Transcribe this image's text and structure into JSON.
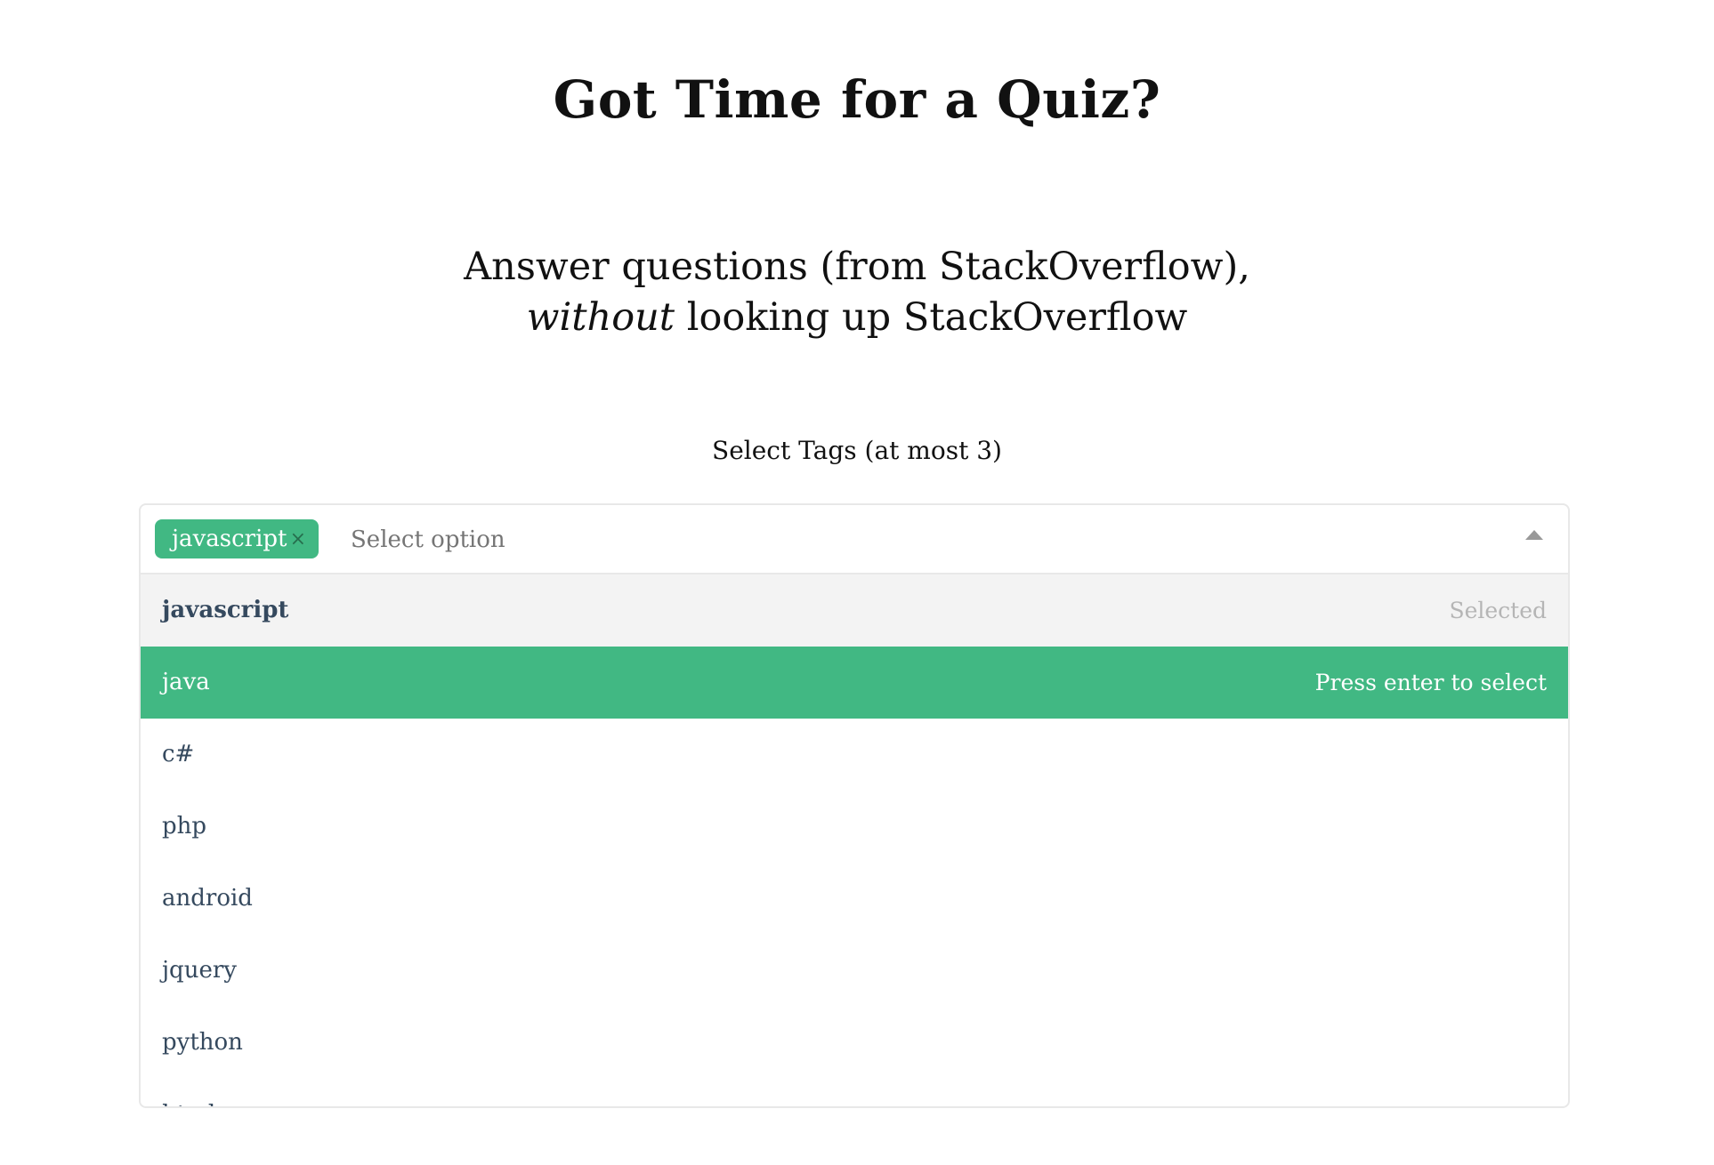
{
  "header": {
    "title": "Got Time for a Quiz?",
    "subtitle_line1": "Answer questions (from StackOverflow),",
    "subtitle_italic": "without",
    "subtitle_line2_rest": " looking up StackOverflow"
  },
  "tag_select": {
    "label": "Select Tags (at most 3)",
    "placeholder": "Select option",
    "selected_tags": [
      {
        "label": "javascript",
        "remove_symbol": "×"
      }
    ],
    "options": [
      {
        "label": "javascript",
        "hint": "Selected",
        "state": "selected"
      },
      {
        "label": "java",
        "hint": "Press enter to select",
        "state": "highlighted"
      },
      {
        "label": "c#",
        "hint": "",
        "state": "normal"
      },
      {
        "label": "php",
        "hint": "",
        "state": "normal"
      },
      {
        "label": "android",
        "hint": "",
        "state": "normal"
      },
      {
        "label": "jquery",
        "hint": "",
        "state": "normal"
      },
      {
        "label": "python",
        "hint": "",
        "state": "normal"
      },
      {
        "label": "html",
        "hint": "",
        "state": "normal"
      }
    ]
  },
  "colors": {
    "accent": "#41b883",
    "option_text": "#35495e",
    "selected_row_bg": "#f3f3f3"
  }
}
